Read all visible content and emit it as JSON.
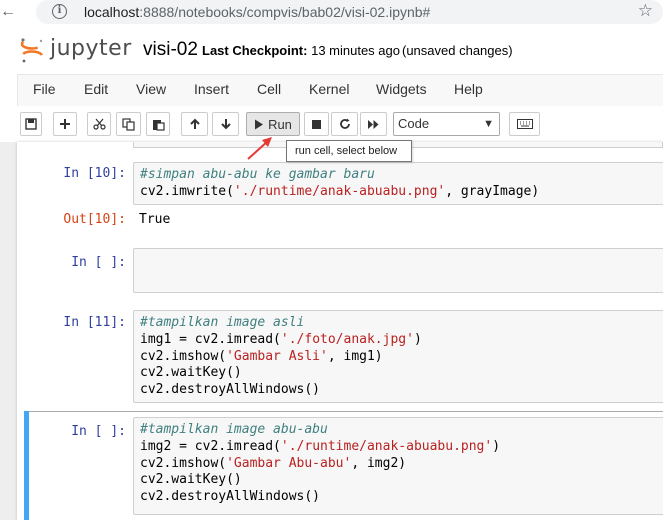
{
  "browser": {
    "url_host": "localhost",
    "url_rest": ":8888/notebooks/compvis/bab02/visi-02.ipynb#"
  },
  "header": {
    "logo_text": "jupyter",
    "notebook_name": "visi-02",
    "checkpoint_label": "Last Checkpoint:",
    "checkpoint_time": "13 minutes ago",
    "save_status": "(unsaved changes)"
  },
  "menu": {
    "items": [
      "File",
      "Edit",
      "View",
      "Insert",
      "Cell",
      "Kernel",
      "Widgets",
      "Help"
    ]
  },
  "toolbar": {
    "run_label": "Run",
    "cell_type": "Code",
    "tooltip": "run cell, select below"
  },
  "cells": [
    {
      "prompt": "In [10]:",
      "lines": [
        [
          {
            "t": "#simpan abu-abu ke gambar baru",
            "c": "cm"
          }
        ],
        [
          {
            "t": "cv2.imwrite(",
            "c": ""
          },
          {
            "t": "'./runtime/anak-abuabu.png'",
            "c": "st"
          },
          {
            "t": ", grayImage)",
            "c": ""
          }
        ]
      ],
      "output_prompt": "Out[10]:",
      "output": "True"
    },
    {
      "prompt": "In [ ]:",
      "lines": []
    },
    {
      "prompt": "In [11]:",
      "lines": [
        [
          {
            "t": "#tampilkan image asli",
            "c": "cm"
          }
        ],
        [
          {
            "t": "img1 = cv2.imread(",
            "c": ""
          },
          {
            "t": "'./foto/anak.jpg'",
            "c": "st"
          },
          {
            "t": ")",
            "c": ""
          }
        ],
        [
          {
            "t": "cv2.imshow(",
            "c": ""
          },
          {
            "t": "'Gambar Asli'",
            "c": "st"
          },
          {
            "t": ", img1)",
            "c": ""
          }
        ],
        [
          {
            "t": "cv2.waitKey()",
            "c": ""
          }
        ],
        [
          {
            "t": "cv2.destroyAllWindows()",
            "c": ""
          }
        ]
      ]
    },
    {
      "prompt": "In [ ]:",
      "lines": [
        [
          {
            "t": "#tampilkan image abu-abu",
            "c": "cm"
          }
        ],
        [
          {
            "t": "img2 = cv2.imread(",
            "c": ""
          },
          {
            "t": "'./runtime/anak-abuabu.png'",
            "c": "st"
          },
          {
            "t": ")",
            "c": ""
          }
        ],
        [
          {
            "t": "cv2.imshow(",
            "c": ""
          },
          {
            "t": "'Gambar Abu-abu'",
            "c": "st"
          },
          {
            "t": ", img2)",
            "c": ""
          }
        ],
        [
          {
            "t": "cv2.waitKey()",
            "c": ""
          }
        ],
        [
          {
            "t": "cv2.destroyAllWindows()",
            "c": ""
          }
        ]
      ]
    }
  ],
  "colors": {
    "in_prompt": "#303f9f",
    "out_prompt": "#d84315",
    "comment": "#408080",
    "string": "#ba2121",
    "selected_bar": "#42a5f5",
    "arrow": "#e53935",
    "logo_orange": "#f37726"
  },
  "icons": [
    "back-arrow-icon",
    "info-icon",
    "star-icon",
    "jupyter-logo-icon",
    "save-icon",
    "plus-icon",
    "scissors-icon",
    "copy-icon",
    "paste-icon",
    "arrow-up-icon",
    "arrow-down-icon",
    "play-icon",
    "stop-icon",
    "restart-icon",
    "fast-forward-icon",
    "keyboard-icon"
  ]
}
